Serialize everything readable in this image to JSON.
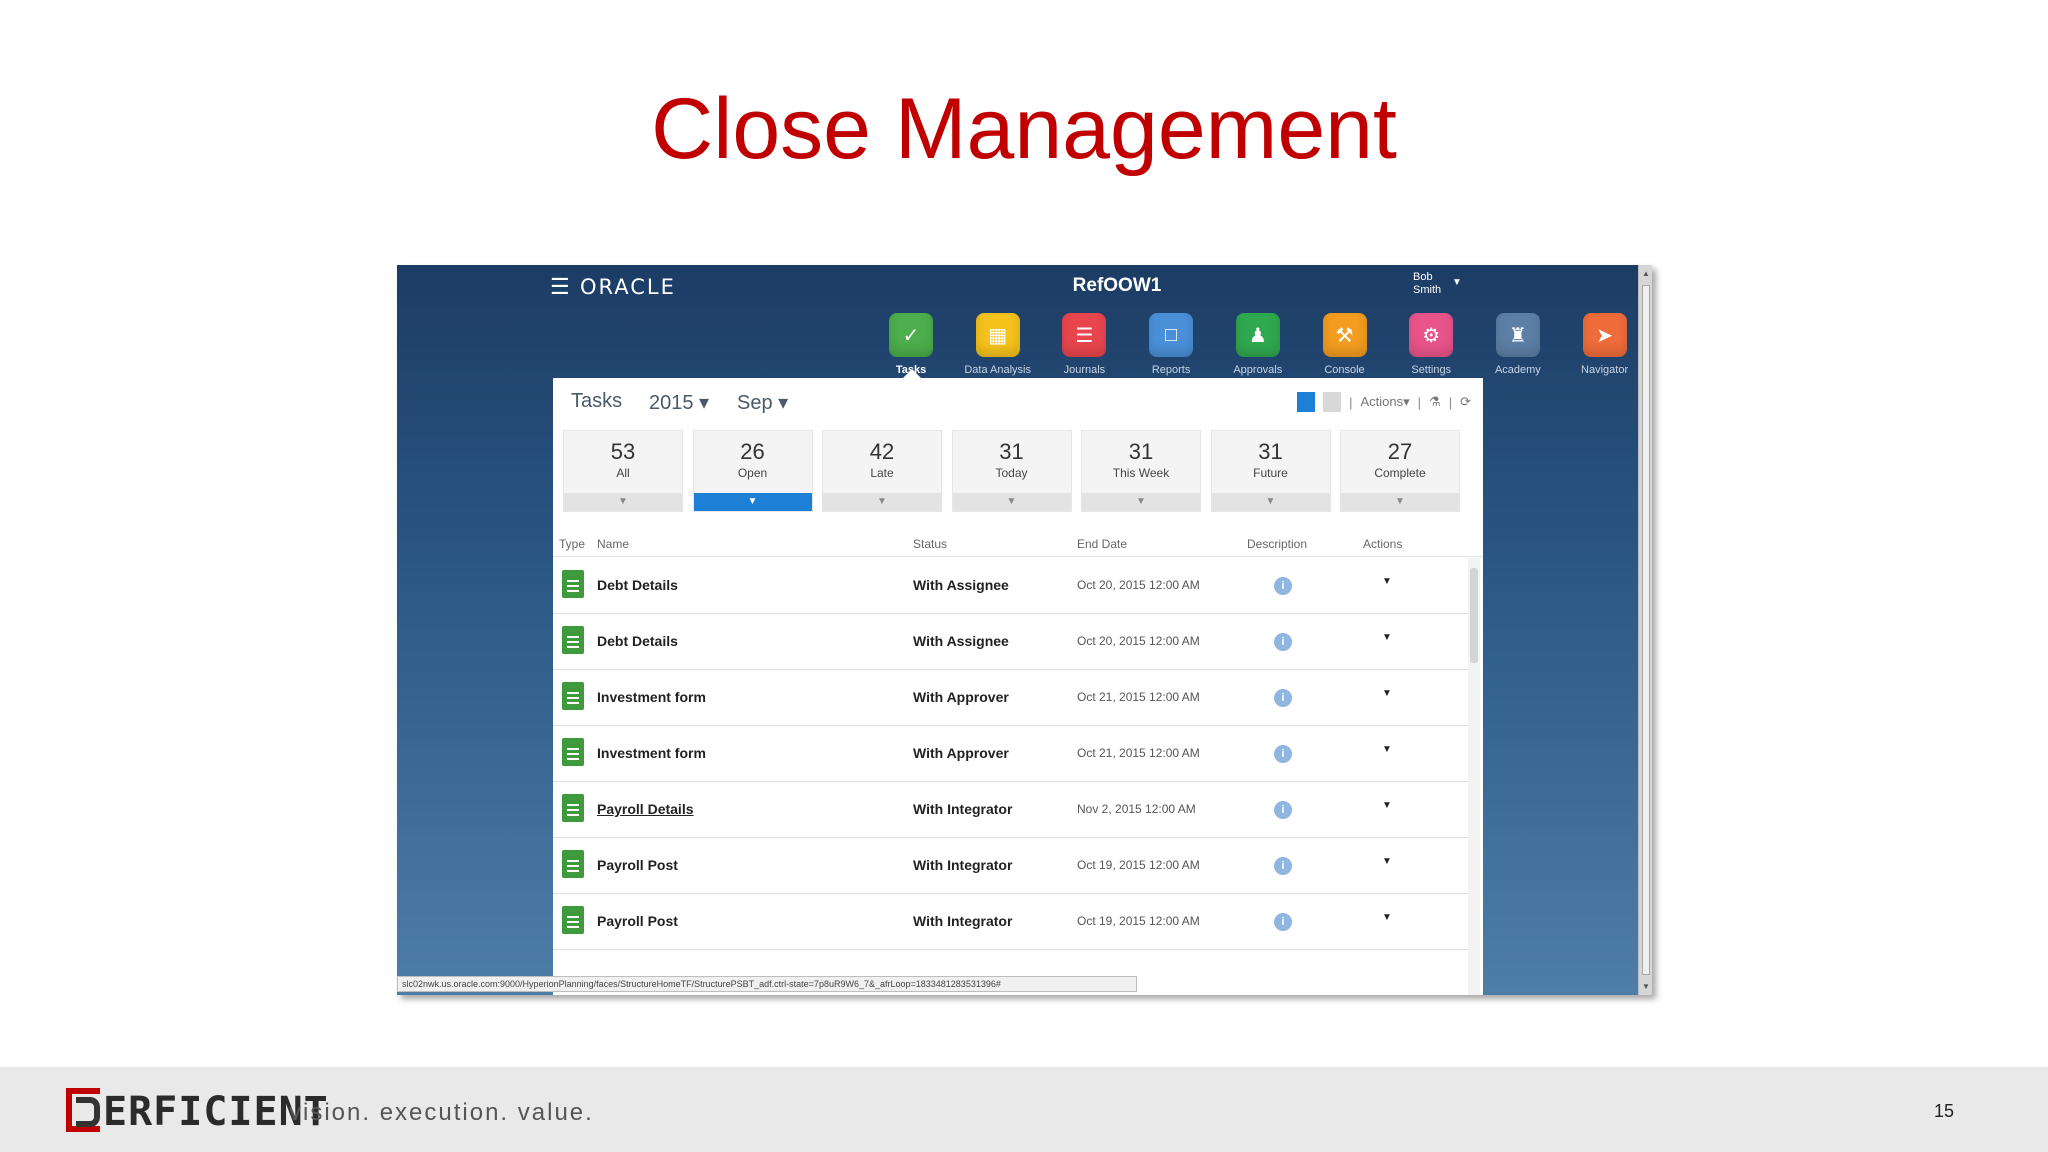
{
  "slide": {
    "title": "Close Management",
    "page_number": "15",
    "footer_logo": "ERFICIENT",
    "footer_tagline": "vision.  execution.  value."
  },
  "app": {
    "vendor": "ORACLE",
    "name": "RefOOW1",
    "user": "Bob Smith",
    "nav": [
      {
        "label": "Tasks",
        "icon": "tasks-icon",
        "color": "#4cae4c",
        "active": true
      },
      {
        "label": "Data Analysis",
        "icon": "data-analysis-icon",
        "color": "#f5c21b"
      },
      {
        "label": "Journals",
        "icon": "journals-icon",
        "color": "#e8454e"
      },
      {
        "label": "Reports",
        "icon": "reports-icon",
        "color": "#4a90d9"
      },
      {
        "label": "Approvals",
        "icon": "approvals-icon",
        "color": "#2fa84f"
      },
      {
        "label": "Console",
        "icon": "console-icon",
        "color": "#f39c1f"
      },
      {
        "label": "Settings",
        "icon": "settings-icon",
        "color": "#e8548a"
      },
      {
        "label": "Academy",
        "icon": "academy-icon",
        "color": "#5b7fa6"
      },
      {
        "label": "Navigator",
        "icon": "navigator-icon",
        "color": "#ef6c3a"
      }
    ]
  },
  "panel": {
    "title": "Tasks",
    "year": "2015",
    "month": "Sep",
    "actions_label": "Actions",
    "tiles": [
      {
        "count": "53",
        "label": "All"
      },
      {
        "count": "26",
        "label": "Open",
        "selected": true
      },
      {
        "count": "42",
        "label": "Late"
      },
      {
        "count": "31",
        "label": "Today"
      },
      {
        "count": "31",
        "label": "This Week"
      },
      {
        "count": "31",
        "label": "Future"
      },
      {
        "count": "27",
        "label": "Complete"
      }
    ],
    "columns": {
      "type": "Type",
      "name": "Name",
      "status": "Status",
      "end_date": "End Date",
      "description": "Description",
      "actions": "Actions"
    },
    "rows": [
      {
        "name": "Debt Details",
        "status": "With Assignee",
        "end_date": "Oct 20, 2015 12:00 AM"
      },
      {
        "name": "Debt Details",
        "status": "With Assignee",
        "end_date": "Oct 20, 2015 12:00 AM"
      },
      {
        "name": "Investment form",
        "status": "With Approver",
        "end_date": "Oct 21, 2015 12:00 AM"
      },
      {
        "name": "Investment form",
        "status": "With Approver",
        "end_date": "Oct 21, 2015 12:00 AM"
      },
      {
        "name": "Payroll Details",
        "status": "With Integrator",
        "end_date": "Nov 2, 2015 12:00 AM",
        "link": true
      },
      {
        "name": "Payroll Post",
        "status": "With Integrator",
        "end_date": "Oct 19, 2015 12:00 AM"
      },
      {
        "name": "Payroll Post",
        "status": "With Integrator",
        "end_date": "Oct 19, 2015 12:00 AM"
      }
    ]
  },
  "browser": {
    "status_url": "slc02nwk.us.oracle.com:9000/HyperionPlanning/faces/StructureHomeTF/StructurePSBT_adf.ctrl-state=7p8uR9W6_7&_afrLoop=1833481283531396#"
  }
}
